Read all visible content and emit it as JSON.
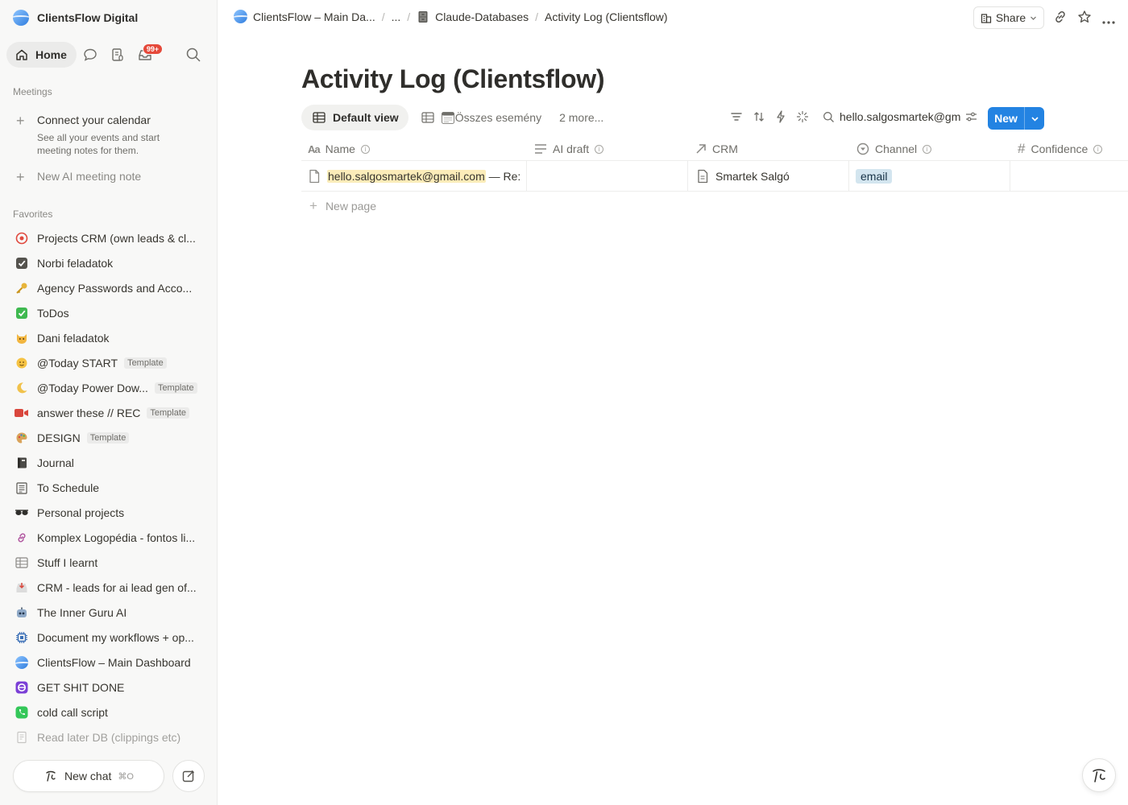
{
  "workspace": {
    "name": "ClientsFlow Digital"
  },
  "nav": {
    "home_label": "Home",
    "inbox_badge": "99+"
  },
  "meetings": {
    "section_label": "Meetings",
    "connect_title": "Connect your calendar",
    "connect_sub": "See all your events and start meeting notes for them.",
    "new_note": "New AI meeting note"
  },
  "favorites": {
    "section_label": "Favorites",
    "template_label": "Template",
    "items": [
      {
        "label": "Projects CRM (own leads & cl...",
        "icon": "target-icon"
      },
      {
        "label": "Norbi feladatok",
        "icon": "checkbox-icon"
      },
      {
        "label": "Agency Passwords and Acco...",
        "icon": "key-icon"
      },
      {
        "label": "ToDos",
        "icon": "green-check-icon"
      },
      {
        "label": "Dani feladatok",
        "icon": "cat-icon"
      },
      {
        "label": "@Today START",
        "icon": "sun-face-icon"
      },
      {
        "label": "@Today Power Dow...",
        "icon": "moon-icon"
      },
      {
        "label": "answer these // REC",
        "icon": "video-camera-icon"
      },
      {
        "label": "DESIGN",
        "icon": "palette-icon"
      },
      {
        "label": "Journal",
        "icon": "notebook-icon"
      },
      {
        "label": "To Schedule",
        "icon": "calendar-doc-icon"
      },
      {
        "label": "Personal projects",
        "icon": "sunglasses-icon"
      },
      {
        "label": "Komplex Logopédia - fontos li...",
        "icon": "link-icon"
      },
      {
        "label": "Stuff I learnt",
        "icon": "table-icon"
      },
      {
        "label": "CRM - leads for ai lead gen of...",
        "icon": "inbox-tray-icon"
      },
      {
        "label": "The Inner Guru AI",
        "icon": "robot-icon"
      },
      {
        "label": "Document my workflows + op...",
        "icon": "chip-icon"
      },
      {
        "label": "ClientsFlow – Main Dashboard",
        "icon": "globe-icon"
      },
      {
        "label": "GET SHIT DONE",
        "icon": "purple-app-icon"
      },
      {
        "label": "cold call script",
        "icon": "phone-icon"
      },
      {
        "label": "Read later DB (clippings etc)",
        "icon": "document-icon"
      }
    ]
  },
  "chat": {
    "new_chat_label": "New chat",
    "shortcut": "⌘O"
  },
  "breadcrumb": {
    "root": "ClientsFlow – Main Da...",
    "ellipsis": "...",
    "parent": "Claude-Databases",
    "current": "Activity Log (Clientsflow)"
  },
  "topbar": {
    "share_label": "Share"
  },
  "page": {
    "title": "Activity Log (Clientsflow)"
  },
  "views": {
    "default_view": "Default view",
    "second_view": "Összes esemény",
    "more": "2 more..."
  },
  "search": {
    "value": "hello.salgosmartek@gm"
  },
  "new_button": {
    "label": "New"
  },
  "table": {
    "columns": [
      {
        "label": "Name",
        "icon": "text-aa-icon"
      },
      {
        "label": "AI draft",
        "icon": "lines-icon"
      },
      {
        "label": "CRM",
        "icon": "relation-arrow-icon"
      },
      {
        "label": "Channel",
        "icon": "select-icon"
      },
      {
        "label": "Confidence",
        "icon": "hash-icon"
      }
    ],
    "rows": [
      {
        "name_highlight": "hello.salgosmartek@gmail.com",
        "name_rest": " — Re:",
        "ai_draft": "",
        "crm": "Smartek Salgó",
        "channel": "email",
        "confidence": ""
      }
    ],
    "new_page_label": "New page"
  },
  "colors": {
    "accent": "#2383e2",
    "highlight": "#fbecb9",
    "tag": "#d3e5ef",
    "badge": "#e5493a"
  }
}
